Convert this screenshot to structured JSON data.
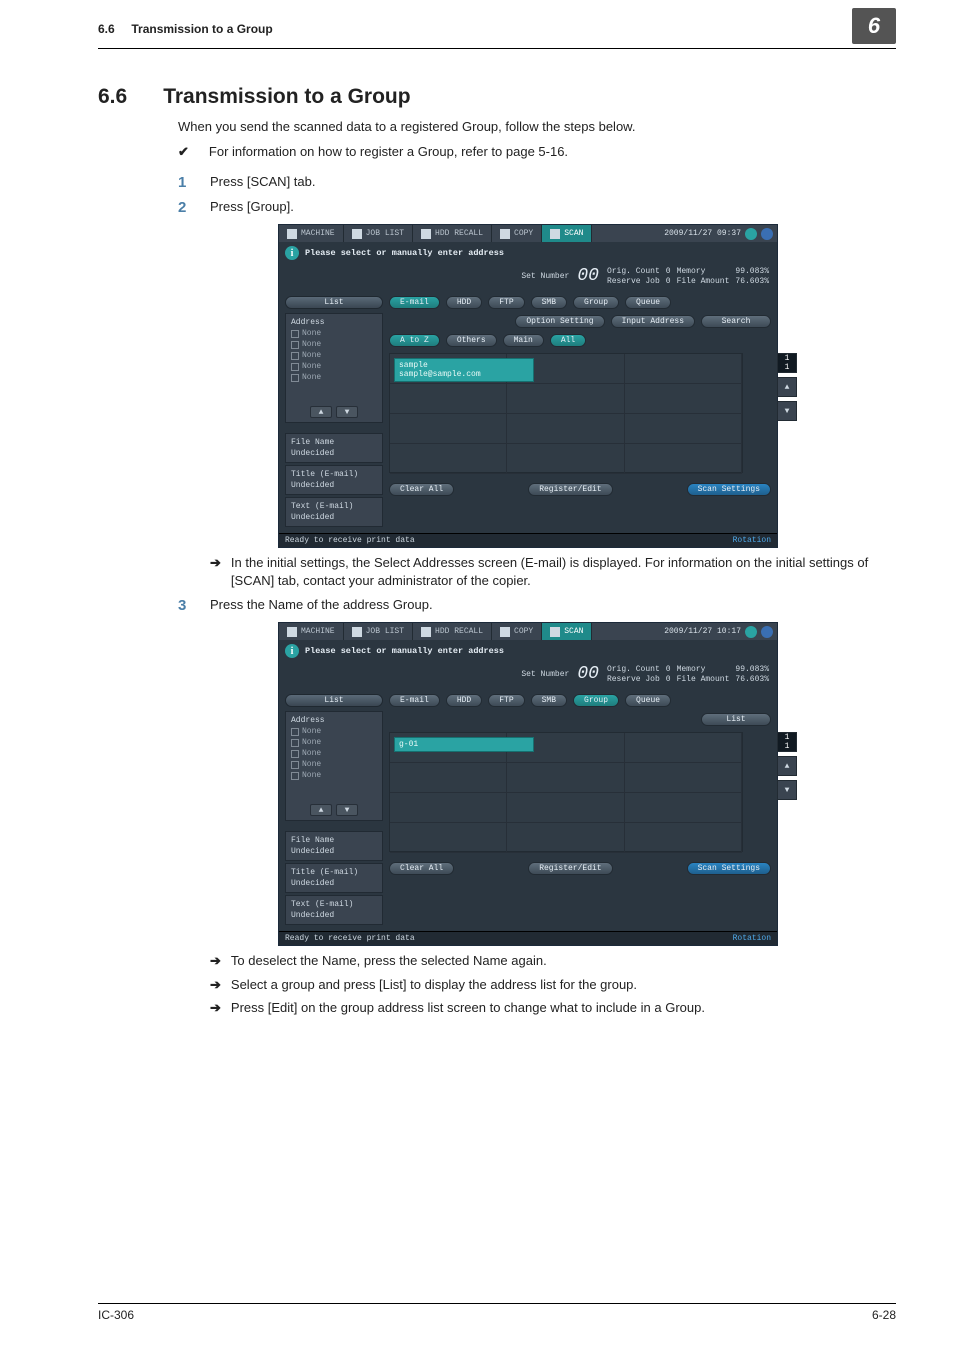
{
  "header": {
    "section_no": "6.6",
    "section_title": "Transmission to a Group",
    "chapter_badge": "6"
  },
  "title": {
    "no": "6.6",
    "text": "Transmission to a Group"
  },
  "intro": "When you send the scanned data to a registered Group, follow the steps below.",
  "check_note": "For information on how to register a Group, refer to page 5-16.",
  "steps": {
    "s1": "Press [SCAN] tab.",
    "s2": "Press [Group].",
    "s2_sub": "In the initial settings, the Select Addresses screen (E-mail) is displayed.  For information on the initial settings of [SCAN] tab, contact your administrator of the copier.",
    "s3": "Press the Name of the address Group.",
    "s3_sub1": "To deselect the Name, press the selected Name again.",
    "s3_sub2": "Select a group and press [List] to display the address list for the group.",
    "s3_sub3": "Press [Edit] on the group address list screen to change what to include in a Group."
  },
  "step_numbers": {
    "n1": "1",
    "n2": "2",
    "n3": "3"
  },
  "shot1": {
    "tabs": {
      "machine": "MACHINE",
      "joblist": "JOB LIST",
      "hdd": "HDD RECALL",
      "copy": "COPY",
      "scan": "SCAN"
    },
    "clock": "2009/11/27 09:37",
    "info_msg": "Please select or manually enter address",
    "setnum": {
      "label": "Set Number",
      "value": "00"
    },
    "counters": {
      "orig": "Orig.  Count",
      "orig_v": "0",
      "mem": "Memory",
      "mem_v": "99.083%",
      "res": "Reserve Job",
      "res_v": "0",
      "fa": "File Amount",
      "fa_v": "76.603%"
    },
    "left": {
      "list": "List",
      "addr_title": "Address",
      "rows": {
        "r1": "None",
        "r2": "None",
        "r3": "None",
        "r4": "None",
        "r5": "None"
      },
      "file_name": "File Name",
      "file_name_v": "Undecided",
      "title_e": "Title (E-mail)",
      "title_e_v": "Undecided",
      "text_e": "Text (E-mail)",
      "text_e_v": "Undecided"
    },
    "right": {
      "tabs": {
        "email": "E-mail",
        "hdd": "HDD",
        "ftp": "FTP",
        "smb": "SMB",
        "group": "Group",
        "queue": "Queue"
      },
      "row2": {
        "opt": "Option Setting",
        "input": "Input Address",
        "search": "Search"
      },
      "row3": {
        "atoz": "A to Z",
        "others": "Others",
        "main": "Main",
        "all": "All"
      },
      "card_head": "sample",
      "card_addr": "sample@sample.com",
      "page": {
        "cur": "1",
        "tot": "1"
      },
      "clear": "Clear All",
      "regedit": "Register/Edit",
      "scanset": "Scan Settings"
    },
    "status_l": "Ready to receive print data",
    "status_r": "Rotation"
  },
  "shot2": {
    "clock": "2009/11/27 10:17",
    "right": {
      "list": "List",
      "card_head": "g-01"
    }
  },
  "footer": {
    "model": "IC-306",
    "page": "6-28"
  }
}
